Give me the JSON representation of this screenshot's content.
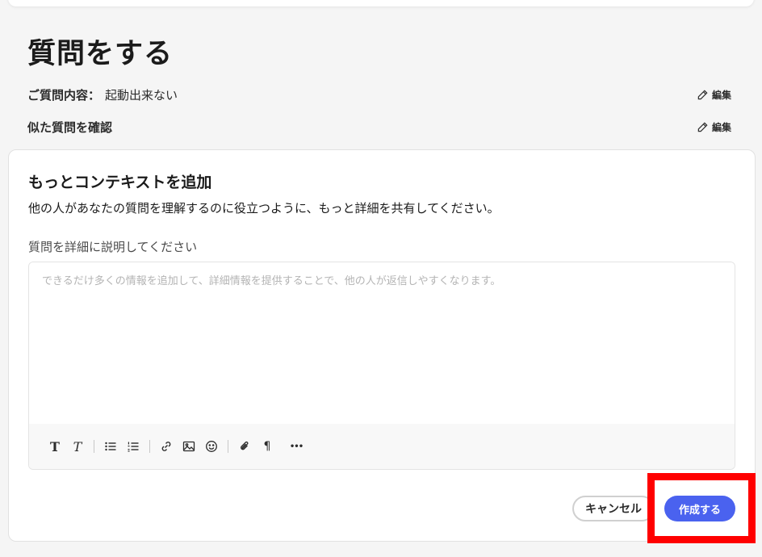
{
  "page": {
    "title": "質問をする"
  },
  "summary": {
    "question_label": "ご質問内容：",
    "question_value": "起動出来ない",
    "similar_label": "似た質問を確認",
    "edit_label": "編集"
  },
  "context": {
    "title": "もっとコンテキストを追加",
    "description": "他の人があなたの質問を理解するのに役立つように、もっと詳細を共有してください。",
    "field_label": "質問を詳細に説明してください",
    "placeholder": "できるだけ多くの情報を追加して、詳細情報を提供することで、他の人が返信しやすくなります。",
    "value": ""
  },
  "toolbar": {
    "bold_glyph": "T",
    "italic_glyph": "T",
    "pilcrow_glyph": "¶",
    "more_glyph": "•••",
    "icons": [
      "bold-icon",
      "italic-icon",
      "bullet-list-icon",
      "numbered-list-icon",
      "link-icon",
      "image-icon",
      "emoji-icon",
      "attachment-icon",
      "paragraph-icon",
      "more-icon"
    ]
  },
  "actions": {
    "cancel_label": "キャンセル",
    "create_label": "作成する"
  },
  "colors": {
    "primary": "#4a62ef",
    "highlight": "#ff0000"
  }
}
